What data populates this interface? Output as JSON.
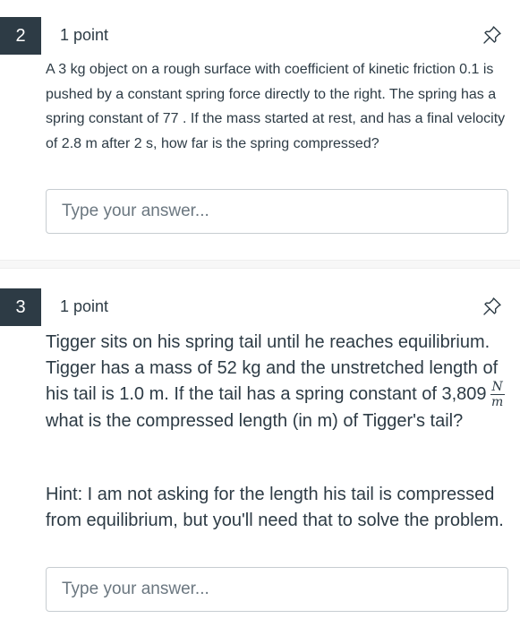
{
  "questions": [
    {
      "number": "2",
      "points": "1 point",
      "text": "A 3 kg object on a rough surface with coefficient of kinetic friction 0.1 is pushed by a constant spring force directly to the right. The spring has a spring constant of  77 .  If the mass started at rest, and has a final velocity of 2.8 m after 2 s, how far is the spring compressed?",
      "answer_placeholder": "Type your answer..."
    },
    {
      "number": "3",
      "points": "1 point",
      "text_before_unit": "Tigger sits on his spring tail until he reaches equilibrium.  Tigger has a mass of 52 kg and the unstretched length of his tail is 1.0 m. If the tail has a spring constant of 3,809",
      "unit_numerator": "N",
      "unit_denominator": "m",
      "text_after_unit": "what is the compressed length (in m) of Tigger's tail?",
      "hint": "Hint: I am not asking for the length his tail is compressed from equilibrium, but you'll need that to solve the problem.",
      "answer_placeholder": "Type your answer..."
    }
  ],
  "icons": {
    "pin": "pushpin-icon"
  },
  "colors": {
    "badge_bg": "#2d3b45",
    "text": "#2d3b45",
    "input_border": "#c7cdd1",
    "placeholder": "#6b7780"
  }
}
